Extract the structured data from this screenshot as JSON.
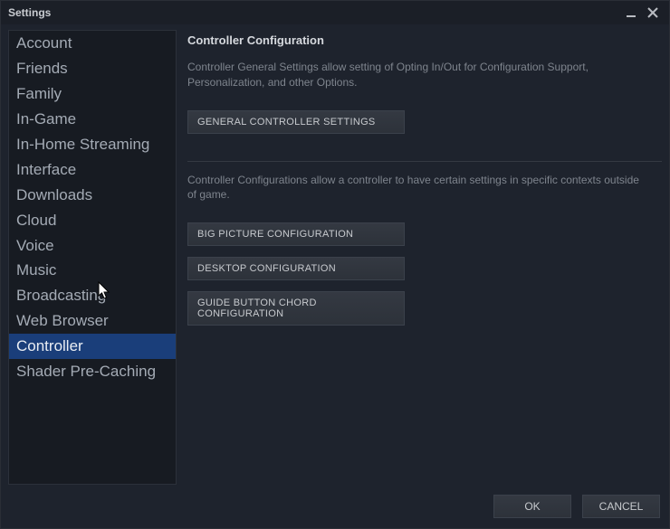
{
  "window": {
    "title": "Settings"
  },
  "sidebar": {
    "items": [
      {
        "label": "Account",
        "selected": false
      },
      {
        "label": "Friends",
        "selected": false
      },
      {
        "label": "Family",
        "selected": false
      },
      {
        "label": "In-Game",
        "selected": false
      },
      {
        "label": "In-Home Streaming",
        "selected": false
      },
      {
        "label": "Interface",
        "selected": false
      },
      {
        "label": "Downloads",
        "selected": false
      },
      {
        "label": "Cloud",
        "selected": false
      },
      {
        "label": "Voice",
        "selected": false
      },
      {
        "label": "Music",
        "selected": false
      },
      {
        "label": "Broadcasting",
        "selected": false
      },
      {
        "label": "Web Browser",
        "selected": false
      },
      {
        "label": "Controller",
        "selected": true
      },
      {
        "label": "Shader Pre-Caching",
        "selected": false
      }
    ]
  },
  "main": {
    "heading": "Controller Configuration",
    "desc1": "Controller General Settings allow setting of Opting In/Out for Configuration Support, Personalization, and other Options.",
    "btn_general": "GENERAL CONTROLLER SETTINGS",
    "desc2": "Controller Configurations allow a controller to have certain settings in specific contexts outside of game.",
    "btn_bigpicture": "BIG PICTURE CONFIGURATION",
    "btn_desktop": "DESKTOP CONFIGURATION",
    "btn_guide": "GUIDE BUTTON CHORD CONFIGURATION"
  },
  "footer": {
    "ok": "OK",
    "cancel": "CANCEL"
  }
}
